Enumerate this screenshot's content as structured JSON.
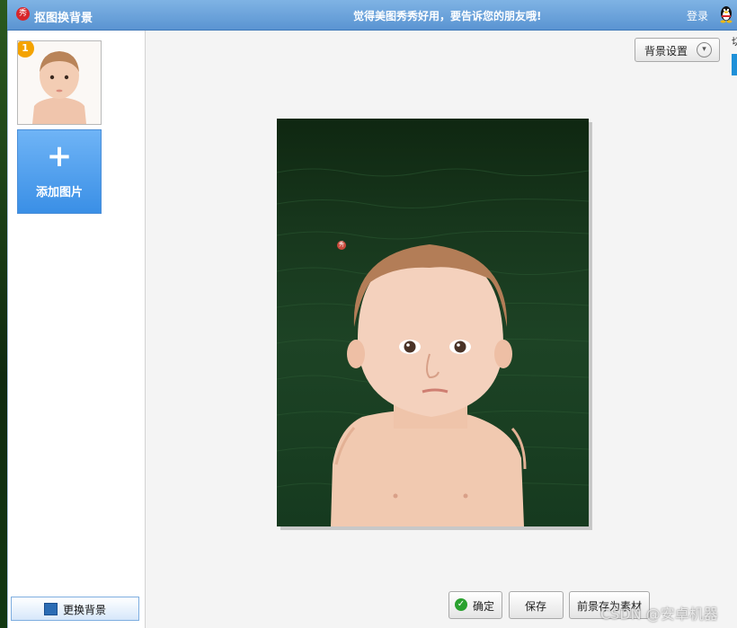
{
  "titlebar": {
    "title": "抠图换背景",
    "slogan": "觉得美图秀秀好用，要告诉您的朋友哦!",
    "login": "登录",
    "logo_text": "秀"
  },
  "sidebar": {
    "thumbnail_badge": "1",
    "add_image_label": "添加图片",
    "add_image_icon": "+",
    "change_background_label": "更换背景"
  },
  "toolbar": {
    "background_settings_label": "背景设置",
    "right_edge_text": "切"
  },
  "canvas": {
    "seal_text": "秀"
  },
  "buttons": {
    "ok_label": "确定",
    "save_label": "保存",
    "save_foreground_label": "前景存为素材"
  },
  "watermark": "CSDN @安卓机器",
  "colors": {
    "titlebar": "#6ea6de",
    "add_button": "#4a9eee",
    "canvas_background": "#183a1e",
    "check_green": "#2aa12f"
  }
}
